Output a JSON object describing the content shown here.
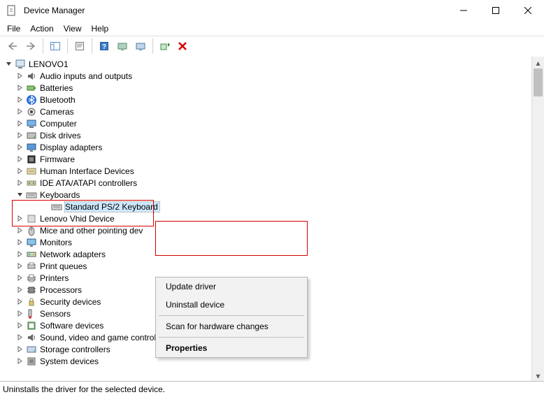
{
  "window": {
    "title": "Device Manager"
  },
  "menu": {
    "file": "File",
    "action": "Action",
    "view": "View",
    "help": "Help"
  },
  "tree": {
    "root": "LENOVO1",
    "items": [
      {
        "label": "Audio inputs and outputs",
        "icon": "audio"
      },
      {
        "label": "Batteries",
        "icon": "battery"
      },
      {
        "label": "Bluetooth",
        "icon": "bluetooth"
      },
      {
        "label": "Cameras",
        "icon": "camera"
      },
      {
        "label": "Computer",
        "icon": "computer"
      },
      {
        "label": "Disk drives",
        "icon": "disk"
      },
      {
        "label": "Display adapters",
        "icon": "display"
      },
      {
        "label": "Firmware",
        "icon": "firmware"
      },
      {
        "label": "Human Interface Devices",
        "icon": "hid"
      },
      {
        "label": "IDE ATA/ATAPI controllers",
        "icon": "ide"
      },
      {
        "label": "Keyboards",
        "icon": "keyboard",
        "expanded": true,
        "children": [
          {
            "label": "Standard PS/2 Keyboard",
            "icon": "keyboard",
            "selected": true
          }
        ]
      },
      {
        "label": "Lenovo Vhid Device",
        "icon": "generic"
      },
      {
        "label": "Mice and other pointing dev",
        "icon": "mouse"
      },
      {
        "label": "Monitors",
        "icon": "monitor"
      },
      {
        "label": "Network adapters",
        "icon": "network"
      },
      {
        "label": "Print queues",
        "icon": "printq"
      },
      {
        "label": "Printers",
        "icon": "printer"
      },
      {
        "label": "Processors",
        "icon": "cpu"
      },
      {
        "label": "Security devices",
        "icon": "security"
      },
      {
        "label": "Sensors",
        "icon": "sensor"
      },
      {
        "label": "Software devices",
        "icon": "software"
      },
      {
        "label": "Sound, video and game controllers",
        "icon": "sound"
      },
      {
        "label": "Storage controllers",
        "icon": "storage"
      },
      {
        "label": "System devices",
        "icon": "system"
      }
    ]
  },
  "context_menu": {
    "update": "Update driver",
    "uninstall": "Uninstall device",
    "scan": "Scan for hardware changes",
    "properties": "Properties"
  },
  "statusbar": {
    "text": "Uninstalls the driver for the selected device."
  }
}
